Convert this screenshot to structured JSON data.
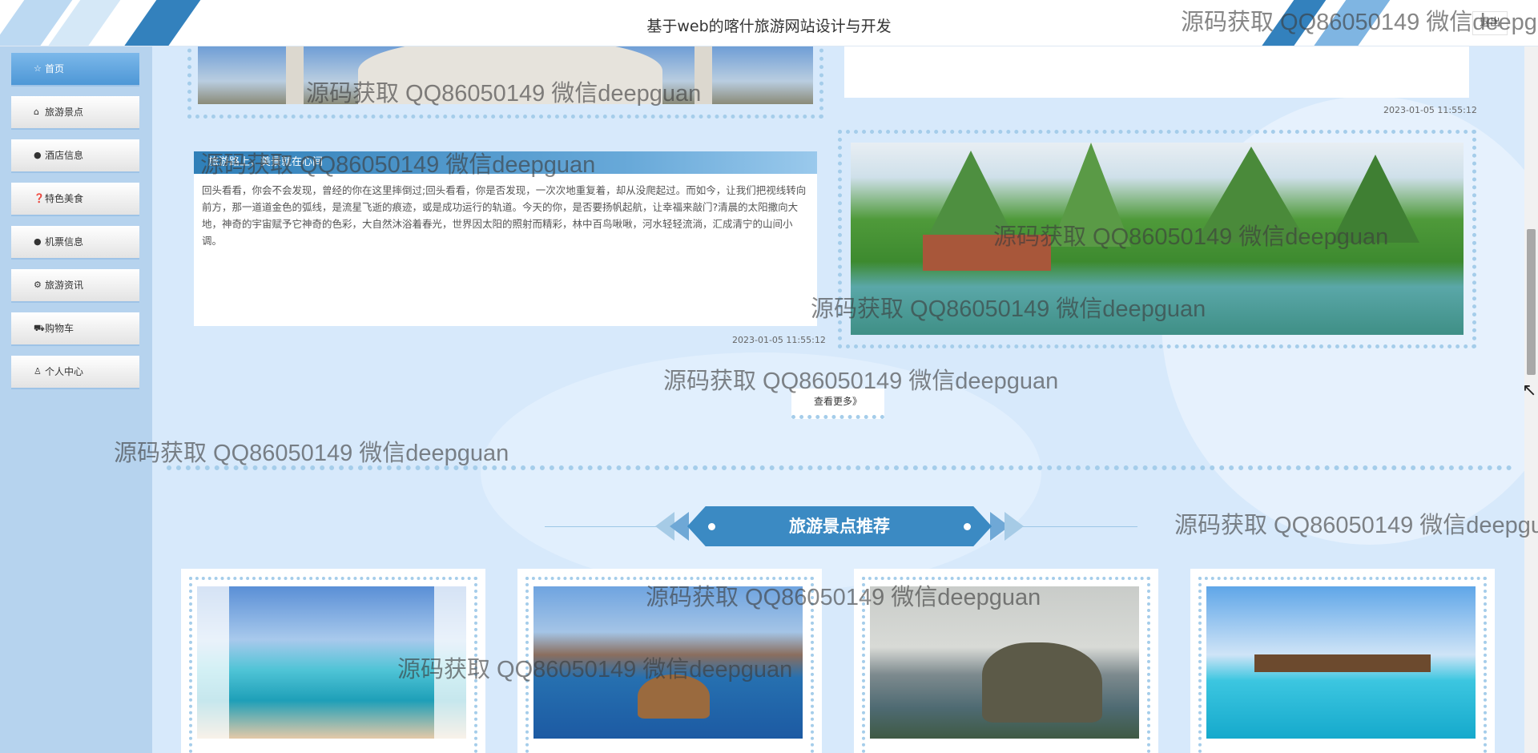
{
  "header": {
    "title": "基于web的喀什旅游网站设计与开发",
    "exit_label": "退出"
  },
  "sidebar": {
    "items": [
      {
        "label": "首页",
        "icon": "☆"
      },
      {
        "label": "旅游景点",
        "icon": "⌂"
      },
      {
        "label": "酒店信息",
        "icon": "●"
      },
      {
        "label": "特色美食",
        "icon": "❓"
      },
      {
        "label": "机票信息",
        "icon": "●"
      },
      {
        "label": "旅游资讯",
        "icon": "⚙"
      },
      {
        "label": "购物车",
        "icon": "⛟"
      },
      {
        "label": "个人中心",
        "icon": "♙"
      }
    ]
  },
  "news": {
    "top_date": "2023-01-05 11:55:12",
    "article_title": "旅游路上，美景就在心间",
    "article_text": "回头看看，你会不会发现，曾经的你在这里摔倒过;回头看看，你是否发现，一次次地重复着，却从没爬起过。而如今，让我们把视线转向前方，那一道道金色的弧线，是流星飞逝的痕迹，或是成功运行的轨道。今天的你，是否要扬帆起航，让幸福来敲门?清晨的太阳撒向大地，神奇的宇宙赋予它神奇的色彩，大自然沐浴着春光，世界因太阳的照射而精彩，林中百鸟啾啾，河水轻轻流淌，汇成清宁的山间小调。",
    "article_date": "2023-01-05 11:55:12",
    "more_label": "查看更多》"
  },
  "section": {
    "title": "旅游景点推荐"
  },
  "watermark": {
    "text": "源码获取 QQ86050149 微信deepguan"
  },
  "colors": {
    "accent": "#3b8ac3",
    "sidebar_bg": "#b6d3ee",
    "page_bg": "#d7e9fb",
    "dots": "#a5cdea"
  }
}
